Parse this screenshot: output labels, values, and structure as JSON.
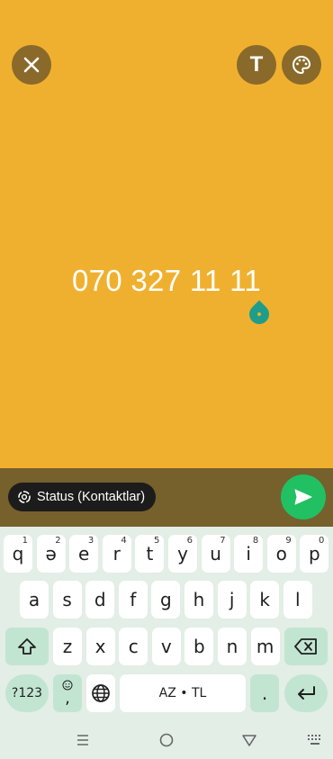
{
  "status": {
    "text": "070 327 11 11",
    "background_color": "#F0B02F"
  },
  "toolbar": {
    "close_icon": "close-icon",
    "text_icon_label": "T",
    "palette_icon": "palette-icon"
  },
  "composer": {
    "audience_label": "Status (Kontaktlar)",
    "send_icon": "send-icon",
    "send_color": "#21C063"
  },
  "keyboard": {
    "row1": [
      {
        "key": "q",
        "hint": "1"
      },
      {
        "key": "ə",
        "hint": "2"
      },
      {
        "key": "e",
        "hint": "3"
      },
      {
        "key": "r",
        "hint": "4"
      },
      {
        "key": "t",
        "hint": "5"
      },
      {
        "key": "y",
        "hint": "6"
      },
      {
        "key": "u",
        "hint": "7"
      },
      {
        "key": "i",
        "hint": "8"
      },
      {
        "key": "o",
        "hint": "9"
      },
      {
        "key": "p",
        "hint": "0"
      }
    ],
    "row2": [
      "a",
      "s",
      "d",
      "f",
      "g",
      "h",
      "j",
      "k",
      "l"
    ],
    "row3": [
      "z",
      "x",
      "c",
      "v",
      "b",
      "n",
      "m"
    ],
    "symbols_label": "?123",
    "emoji_comma_label": ",",
    "space_label": "AZ • TL",
    "period_label": "."
  }
}
